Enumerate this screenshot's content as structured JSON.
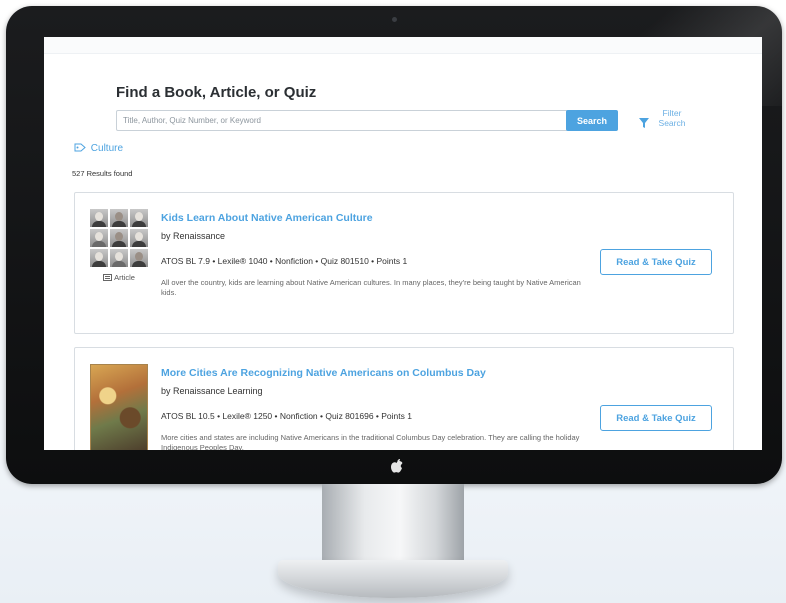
{
  "page": {
    "heading": "Find a Book, Article, or Quiz"
  },
  "search": {
    "placeholder": "Title, Author, Quiz Number, or Keyword",
    "value": "",
    "button_label": "Search"
  },
  "filter": {
    "label": "Filter Search",
    "icon": "funnel-icon"
  },
  "breadcrumb": {
    "label": "Culture",
    "icon": "tag-icon"
  },
  "results": {
    "count_text": "527 Results found",
    "items": [
      {
        "title": "Kids Learn About Native American Culture",
        "author": "by Renaissance",
        "meta": "ATOS BL 7.9 • Lexile® 1040 • Nonfiction • Quiz 801510 • Points 1",
        "description": "All over the country, kids are learning about Native American cultures. In many places, they're being taught by Native American kids.",
        "type": "Article",
        "action": "Read & Take Quiz"
      },
      {
        "title": "More Cities Are Recognizing Native Americans on Columbus Day",
        "author": "by Renaissance Learning",
        "meta": "ATOS BL 10.5 • Lexile® 1250 • Nonfiction • Quiz 801696 • Points 1",
        "description": "More cities and states are including Native Americans in the traditional Columbus Day celebration. They are calling the holiday Indigenous Peoples Day.",
        "action": "Read & Take Quiz"
      }
    ]
  },
  "colors": {
    "accent": "#4da3e0",
    "text": "#333333",
    "bezel": "#111214"
  }
}
